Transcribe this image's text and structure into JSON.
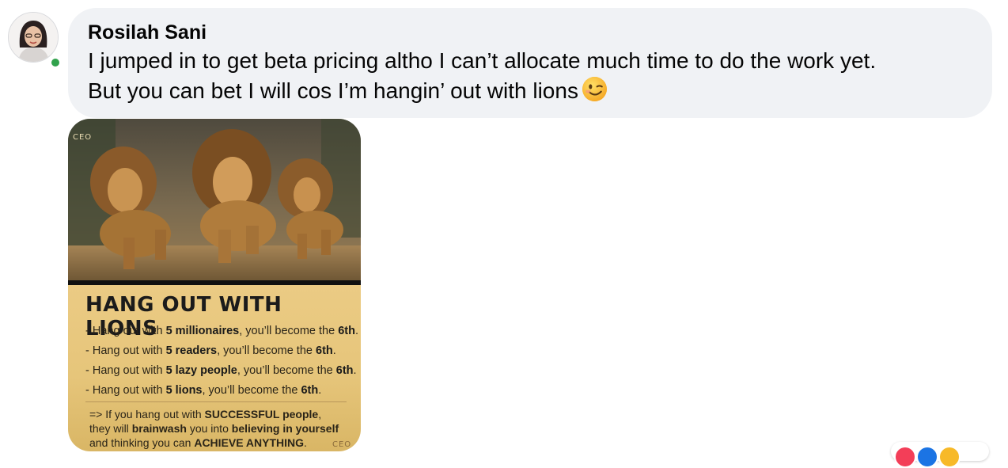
{
  "comment": {
    "author": "Rosilah Sani",
    "text": "I jumped in to get beta pricing altho I can’t allocate much time to do the work yet.\nBut you can bet I will cos I’m hangin’ out with lions",
    "emoji": "winking-face",
    "presence": "online"
  },
  "attachment": {
    "brand_mark": "CEO",
    "poster": {
      "title": "HANG OUT WITH LIONS",
      "lines": [
        {
          "pre": "- Hang out with ",
          "bold": "5 millionaires",
          "mid": ", you’ll become the ",
          "end": "6th",
          "post": "."
        },
        {
          "pre": "- Hang out with ",
          "bold": "5 readers",
          "mid": ", you’ll become the ",
          "end": "6th",
          "post": "."
        },
        {
          "pre": "- Hang out with ",
          "bold": "5 lazy people",
          "mid": ", you’ll become the ",
          "end": "6th",
          "post": "."
        },
        {
          "pre": "- Hang out with ",
          "bold": "5 lions",
          "mid": ", you’ll become the ",
          "end": "6th",
          "post": "."
        }
      ],
      "closing": {
        "l1_pre": "=> If you hang out with ",
        "l1_bold": "SUCCESSFUL people",
        "l1_post": ",",
        "l2_pre": "they will ",
        "l2_b1": "brainwash",
        "l2_mid": " you into ",
        "l2_b2": "believing in yourself",
        "l3_pre": "and thinking you can ",
        "l3_bold": "ACHIEVE ANYTHING",
        "l3_post": "."
      }
    }
  },
  "reactions": [
    "love-icon",
    "like-icon",
    "haha-icon"
  ],
  "colors": {
    "bubble": "#f0f2f5",
    "online": "#31a24c",
    "text": "#050505"
  }
}
